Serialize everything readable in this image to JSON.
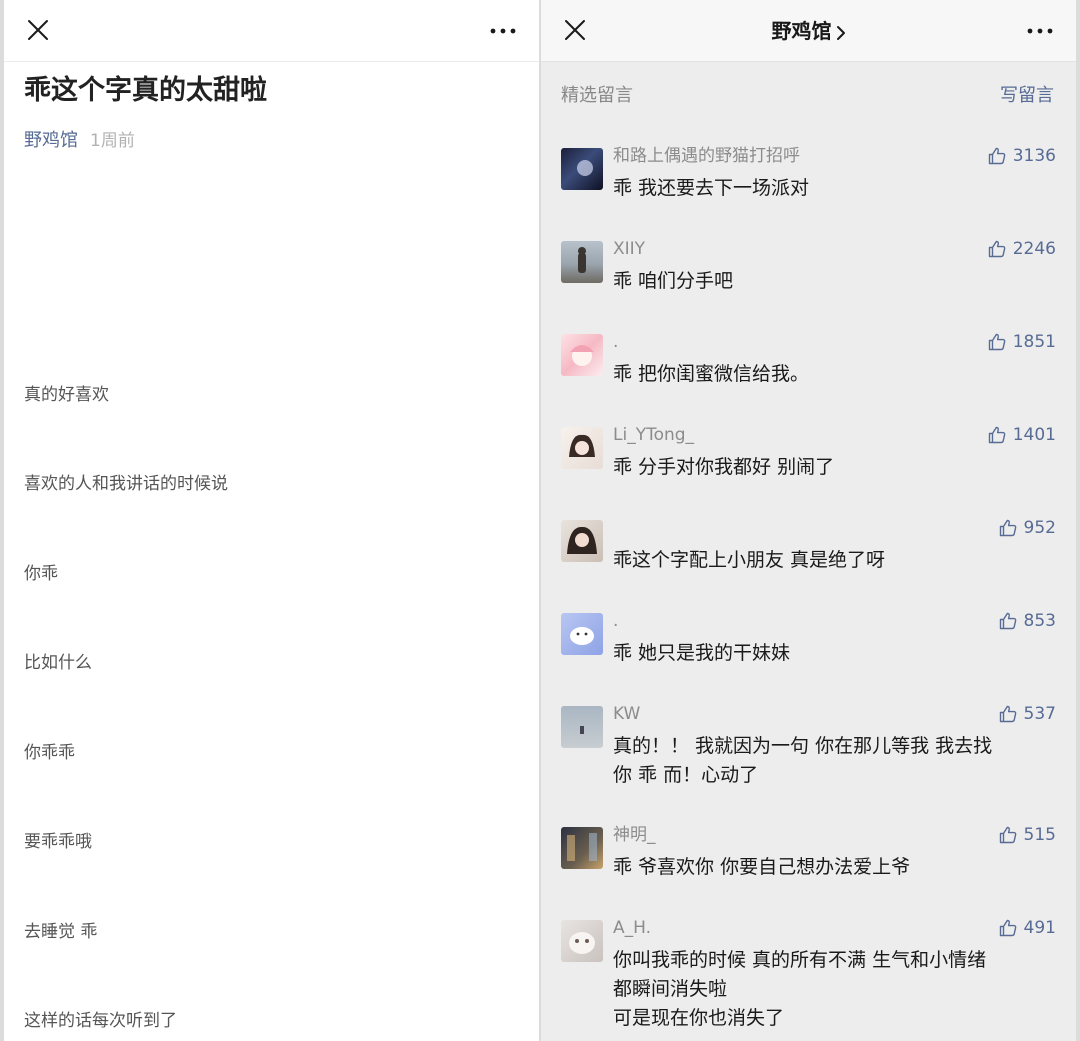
{
  "left": {
    "article_title": "乖这个字真的太甜啦",
    "author": "野鸡馆",
    "time": "1周前",
    "paragraphs": [
      "真的好喜欢",
      "喜欢的人和我讲话的时候说",
      "你乖",
      "比如什么",
      "你乖乖",
      "要乖乖哦",
      "去睡觉 乖",
      "这样的话每次听到了"
    ]
  },
  "right": {
    "account_name": "野鸡馆",
    "section_label": "精选留言",
    "write_label": "写留言",
    "comments": [
      {
        "name": "和路上偶遇的野猫打招呼",
        "likes": "3136",
        "text": "乖 我还要去下一场派对"
      },
      {
        "name": "XIIY",
        "likes": "2246",
        "text": "乖 咱们分手吧"
      },
      {
        "name": ".",
        "likes": "1851",
        "text": "乖 把你闺蜜微信给我。"
      },
      {
        "name": "Li_YTong_",
        "likes": "1401",
        "text": "乖 分手对你我都好 别闹了"
      },
      {
        "name": "",
        "likes": "952",
        "text": "乖这个字配上小朋友 真是绝了呀"
      },
      {
        "name": ".",
        "likes": "853",
        "text": "乖 她只是我的干妹妹"
      },
      {
        "name": "KW",
        "likes": "537",
        "text": "真的！！ 我就因为一句 你在那儿等我 我去找\n你 乖 而！心动了"
      },
      {
        "name": "神明_",
        "likes": "515",
        "text": "乖 爷喜欢你 你要自己想办法爱上爷"
      },
      {
        "name": "A_H.",
        "likes": "491",
        "text": "你叫我乖的时候 真的所有不满 生气和小情绪\n都瞬间消失啦\n可是现在你也消失了"
      }
    ]
  },
  "colors": {
    "link": "#576b95",
    "right_bg": "#ededed",
    "left_bg": "#ffffff"
  },
  "icons": [
    "close-icon",
    "more-icon",
    "chevron-right-icon",
    "thumbs-up-icon"
  ]
}
